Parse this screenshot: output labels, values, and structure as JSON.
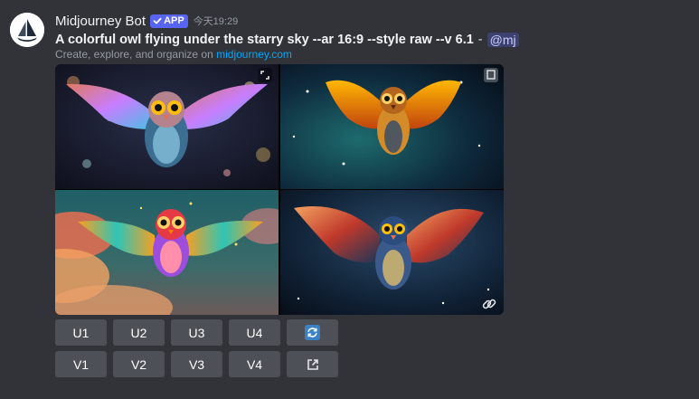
{
  "bot": {
    "name": "Midjourney Bot",
    "badge": "APP",
    "timestamp": "今天19:29",
    "avatar_icon": "midjourney-sailboat-logo"
  },
  "message": {
    "prompt": "A colorful owl flying under the starry sky --ar 16:9 --style raw --v 6.1",
    "separator": "-",
    "mention": "@mj",
    "subline_prefix": "Create, explore, and organize on ",
    "subline_link": "midjourney.com"
  },
  "image_grid": {
    "tiles": [
      {
        "subject": "owl-with-spread-wings-bokeh-night"
      },
      {
        "subject": "golden-owl-in-nebula"
      },
      {
        "subject": "cartoon-owl-over-sunset-clouds"
      },
      {
        "subject": "blue-gold-owl-in-galaxy"
      }
    ],
    "icons": [
      "expand-icon",
      "link-icon"
    ]
  },
  "buttons": {
    "upscale": [
      "U1",
      "U2",
      "U3",
      "U4"
    ],
    "variation": [
      "V1",
      "V2",
      "V3",
      "V4"
    ],
    "reroll_icon": "refresh-icon",
    "web_icon": "external-link-icon"
  },
  "colors": {
    "background": "#313338",
    "button": "#4e5058",
    "badge": "#5865f2",
    "link": "#00a8fc",
    "reroll": "#3b82c4"
  }
}
